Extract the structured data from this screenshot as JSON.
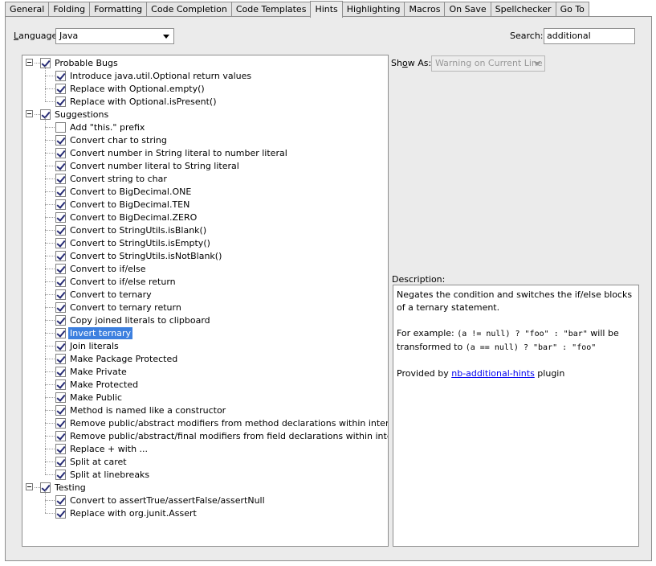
{
  "tabs": [
    {
      "label": "General"
    },
    {
      "label": "Folding"
    },
    {
      "label": "Formatting"
    },
    {
      "label": "Code Completion"
    },
    {
      "label": "Code Templates"
    },
    {
      "label": "Hints",
      "active": true
    },
    {
      "label": "Highlighting"
    },
    {
      "label": "Macros"
    },
    {
      "label": "On Save"
    },
    {
      "label": "Spellchecker"
    },
    {
      "label": "Go To"
    }
  ],
  "language": {
    "label_prefix": "",
    "label_mnemonic": "L",
    "label_rest": "anguage:",
    "value": "Java"
  },
  "search": {
    "label": "Search:",
    "value": "additional"
  },
  "show_as": {
    "label_prefix": "Sh",
    "label_mnemonic": "o",
    "label_rest": "w As:",
    "value": "Warning on Current Line",
    "enabled": false
  },
  "tree": {
    "groups": [
      {
        "label": "Probable Bugs",
        "checked": true,
        "items": [
          {
            "label": "Introduce java.util.Optional return values",
            "checked": true
          },
          {
            "label": "Replace with Optional.empty()",
            "checked": true
          },
          {
            "label": "Replace with Optional.isPresent()",
            "checked": true
          }
        ]
      },
      {
        "label": "Suggestions",
        "checked": true,
        "items": [
          {
            "label": "Add \"this.\" prefix",
            "checked": false
          },
          {
            "label": "Convert char to string",
            "checked": true
          },
          {
            "label": "Convert number in String literal to number literal",
            "checked": true
          },
          {
            "label": "Convert number literal to String literal",
            "checked": true
          },
          {
            "label": "Convert string to char",
            "checked": true
          },
          {
            "label": "Convert to BigDecimal.ONE",
            "checked": true
          },
          {
            "label": "Convert to BigDecimal.TEN",
            "checked": true
          },
          {
            "label": "Convert to BigDecimal.ZERO",
            "checked": true
          },
          {
            "label": "Convert to StringUtils.isBlank()",
            "checked": true
          },
          {
            "label": "Convert to StringUtils.isEmpty()",
            "checked": true
          },
          {
            "label": "Convert to StringUtils.isNotBlank()",
            "checked": true
          },
          {
            "label": "Convert to if/else",
            "checked": true
          },
          {
            "label": "Convert to if/else return",
            "checked": true
          },
          {
            "label": "Convert to ternary",
            "checked": true
          },
          {
            "label": "Convert to ternary return",
            "checked": true
          },
          {
            "label": "Copy joined literals to clipboard",
            "checked": true
          },
          {
            "label": "Invert ternary",
            "checked": true,
            "selected": true
          },
          {
            "label": "Join literals",
            "checked": true
          },
          {
            "label": "Make Package Protected",
            "checked": true
          },
          {
            "label": "Make Private",
            "checked": true
          },
          {
            "label": "Make Protected",
            "checked": true
          },
          {
            "label": "Make Public",
            "checked": true
          },
          {
            "label": "Method is named like a constructor",
            "checked": true
          },
          {
            "label": "Remove public/abstract modifiers from method declarations within interfaces",
            "checked": true
          },
          {
            "label": "Remove public/abstract/final modifiers from field declarations within interfaces",
            "checked": true
          },
          {
            "label": "Replace + with ...",
            "checked": true
          },
          {
            "label": "Split at caret",
            "checked": true
          },
          {
            "label": "Split at linebreaks",
            "checked": true
          }
        ]
      },
      {
        "label": "Testing",
        "checked": true,
        "items": [
          {
            "label": "Convert to assertTrue/assertFalse/assertNull",
            "checked": true
          },
          {
            "label": "Replace with org.junit.Assert",
            "checked": true
          }
        ]
      }
    ]
  },
  "description": {
    "label": "Description:",
    "line1": "Negates the condition and switches the if/else blocks of a ternary statement.",
    "ex_prefix": "For example: ",
    "ex_code1": "(a != null) ? \"foo\" : \"bar\"",
    "ex_mid": " will be transformed to ",
    "ex_code2": "(a == null) ? \"bar\" : \"foo\"",
    "provided_prefix": "Provided by ",
    "provided_link": "nb-additional-hints",
    "provided_suffix": " plugin"
  }
}
